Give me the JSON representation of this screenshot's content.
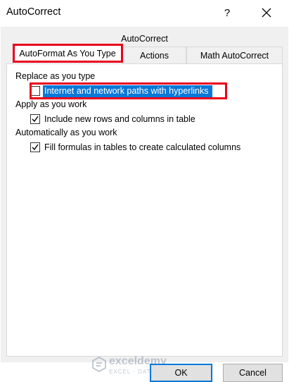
{
  "window": {
    "title": "AutoCorrect",
    "help_label": "?"
  },
  "dialog": {
    "group_label": "AutoCorrect",
    "tabs": [
      {
        "label": "AutoFormat As You Type",
        "active": true
      },
      {
        "label": "Actions",
        "active": false
      },
      {
        "label": "Math AutoCorrect",
        "active": false
      }
    ],
    "sections": [
      {
        "heading": "Replace as you type",
        "options": [
          {
            "label": "Internet and network paths with hyperlinks",
            "checked": false,
            "selected": true
          }
        ]
      },
      {
        "heading": "Apply as you work",
        "options": [
          {
            "label": "Include new rows and columns in table",
            "checked": true,
            "selected": false
          }
        ]
      },
      {
        "heading": "Automatically as you work",
        "options": [
          {
            "label": "Fill formulas in tables to create calculated columns",
            "checked": true,
            "selected": false
          }
        ]
      }
    ],
    "buttons": {
      "ok": "OK",
      "cancel": "Cancel"
    }
  },
  "watermark": {
    "name": "exceldemy",
    "tagline": "EXCEL · DATA · BI"
  },
  "colors": {
    "highlight": "#0a78d7",
    "annotation_red": "#e8001c",
    "ok_border": "#0078d7"
  }
}
